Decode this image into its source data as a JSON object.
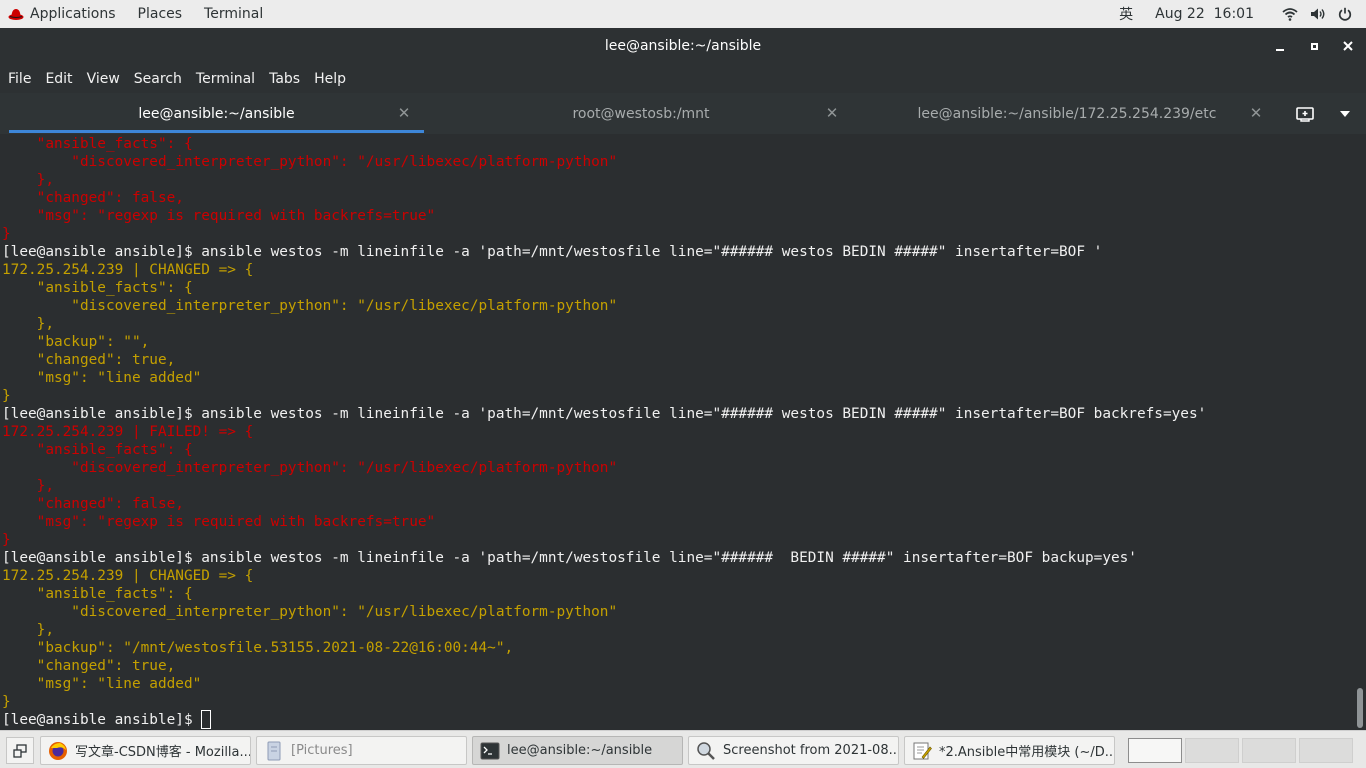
{
  "topbar": {
    "applications": "Applications",
    "places": "Places",
    "terminal": "Terminal",
    "input_method": "英",
    "clock": "Aug 22  16:01",
    "icons": [
      "wifi-icon",
      "volume-icon",
      "power-icon"
    ]
  },
  "window": {
    "title": "lee@ansible:~/ansible"
  },
  "menubar": {
    "items": [
      "File",
      "Edit",
      "View",
      "Search",
      "Terminal",
      "Tabs",
      "Help"
    ]
  },
  "tabs": [
    {
      "label": "lee@ansible:~/ansible",
      "active": true
    },
    {
      "label": "root@westosb:/mnt",
      "active": false
    },
    {
      "label": "lee@ansible:~/ansible/172.25.254.239/etc",
      "active": false
    }
  ],
  "terminal": {
    "lines": [
      {
        "color": "red",
        "text": "    \"ansible_facts\": {"
      },
      {
        "color": "red",
        "text": "        \"discovered_interpreter_python\": \"/usr/libexec/platform-python\""
      },
      {
        "color": "red",
        "text": "    },"
      },
      {
        "color": "red",
        "text": "    \"changed\": false,"
      },
      {
        "color": "red",
        "text": "    \"msg\": \"regexp is required with backrefs=true\""
      },
      {
        "color": "red",
        "text": "}"
      },
      {
        "color": "white",
        "text": "[lee@ansible ansible]$ ansible westos -m lineinfile -a 'path=/mnt/westosfile line=\"###### westos BEDIN #####\" insertafter=BOF '"
      },
      {
        "color": "yellow",
        "text": "172.25.254.239 | CHANGED => {"
      },
      {
        "color": "yellow",
        "text": "    \"ansible_facts\": {"
      },
      {
        "color": "yellow",
        "text": "        \"discovered_interpreter_python\": \"/usr/libexec/platform-python\""
      },
      {
        "color": "yellow",
        "text": "    },"
      },
      {
        "color": "yellow",
        "text": "    \"backup\": \"\","
      },
      {
        "color": "yellow",
        "text": "    \"changed\": true,"
      },
      {
        "color": "yellow",
        "text": "    \"msg\": \"line added\""
      },
      {
        "color": "yellow",
        "text": "}"
      },
      {
        "color": "white",
        "text": "[lee@ansible ansible]$ ansible westos -m lineinfile -a 'path=/mnt/westosfile line=\"###### westos BEDIN #####\" insertafter=BOF backrefs=yes'"
      },
      {
        "color": "red",
        "text": "172.25.254.239 | FAILED! => {"
      },
      {
        "color": "red",
        "text": "    \"ansible_facts\": {"
      },
      {
        "color": "red",
        "text": "        \"discovered_interpreter_python\": \"/usr/libexec/platform-python\""
      },
      {
        "color": "red",
        "text": "    },"
      },
      {
        "color": "red",
        "text": "    \"changed\": false,"
      },
      {
        "color": "red",
        "text": "    \"msg\": \"regexp is required with backrefs=true\""
      },
      {
        "color": "red",
        "text": "}"
      },
      {
        "color": "white",
        "text": "[lee@ansible ansible]$ ansible westos -m lineinfile -a 'path=/mnt/westosfile line=\"######  BEDIN #####\" insertafter=BOF backup=yes'"
      },
      {
        "color": "yellow",
        "text": "172.25.254.239 | CHANGED => {"
      },
      {
        "color": "yellow",
        "text": "    \"ansible_facts\": {"
      },
      {
        "color": "yellow",
        "text": "        \"discovered_interpreter_python\": \"/usr/libexec/platform-python\""
      },
      {
        "color": "yellow",
        "text": "    },"
      },
      {
        "color": "yellow",
        "text": "    \"backup\": \"/mnt/westosfile.53155.2021-08-22@16:00:44~\","
      },
      {
        "color": "yellow",
        "text": "    \"changed\": true,"
      },
      {
        "color": "yellow",
        "text": "    \"msg\": \"line added\""
      },
      {
        "color": "yellow",
        "text": "}"
      },
      {
        "color": "white",
        "text": "[lee@ansible ansible]$ "
      }
    ]
  },
  "taskbar": {
    "tasks": [
      {
        "label": "写文章-CSDN博客 - Mozilla...",
        "icon": "firefox-icon",
        "active": false
      },
      {
        "label": "[Pictures]",
        "icon": "file-manager-icon",
        "active": false
      },
      {
        "label": "lee@ansible:~/ansible",
        "icon": "terminal-icon",
        "active": true
      },
      {
        "label": "Screenshot from 2021-08...",
        "icon": "image-viewer-icon",
        "active": false
      },
      {
        "label": "*2.Ansible中常用模块 (~/D...",
        "icon": "text-editor-icon",
        "active": false
      }
    ],
    "workspaces": 4,
    "active_workspace": 1
  },
  "colors": {
    "terminal_bg": "#2b2e30",
    "text_white": "#f0f0f0",
    "text_red": "#cc0000",
    "text_yellow": "#c4a000",
    "tab_accent": "#3d86d8"
  }
}
